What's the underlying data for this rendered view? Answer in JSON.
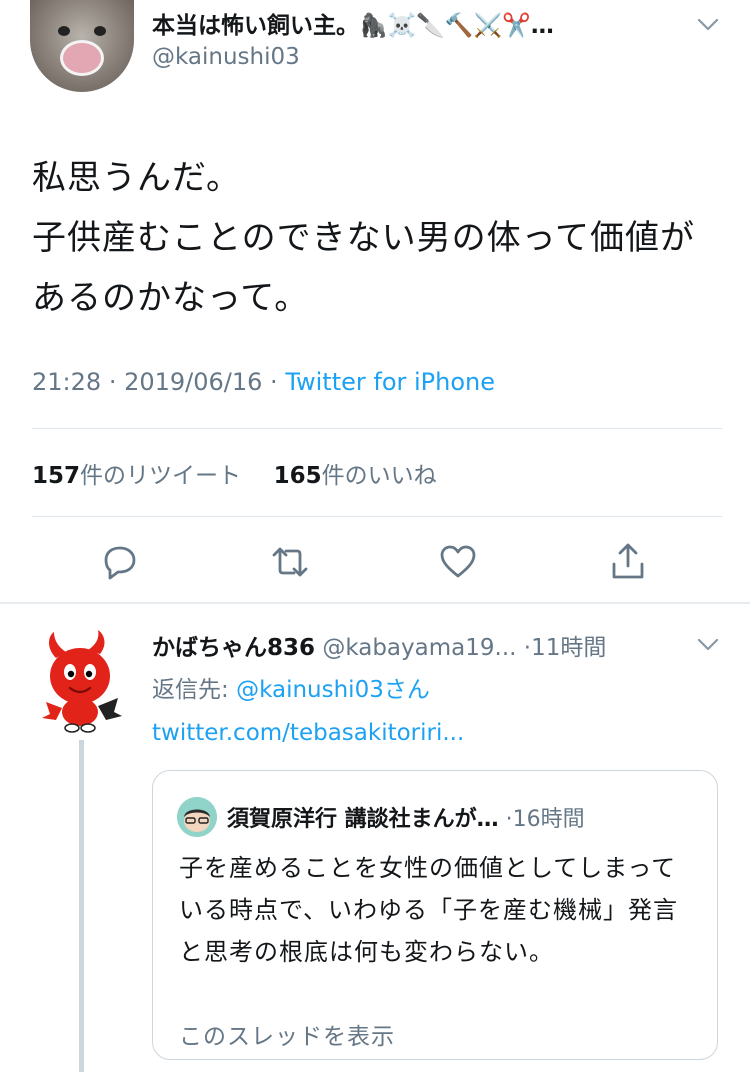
{
  "tweet": {
    "display_name": "本当は怖い飼い主。🦍☠️🔪🔨⚔️✂️…",
    "handle": "@kainushi03",
    "text": "私思うんだ。\n子供産むことのできない男の体って価値があるのかなって。",
    "time": "21:28",
    "date": "2019/06/16",
    "source": "Twitter for iPhone",
    "retweet_count": "157",
    "retweet_label": "件のリツイート",
    "like_count": "165",
    "like_label": "件のいいね"
  },
  "reply": {
    "display_name": "かばちゃん836",
    "handle": "@kabayama19...",
    "time": "11時間",
    "reply_to_label": "返信先: ",
    "reply_to_mention": "@kainushi03さん",
    "link_text": "twitter.com/tebasakitoriri..."
  },
  "quote": {
    "display_name": "須賀原洋行 講談社まんが…",
    "time": "16時間",
    "text": "子を産めることを女性の価値としてしまっている時点で、いわゆる「子を産む機械」発言と思考の根底は何も変わらない。",
    "show_thread": "このスレッドを表示"
  },
  "icons": {
    "actions": [
      "reply-icon",
      "retweet-icon",
      "like-icon",
      "share-icon"
    ],
    "caret": "chevron-down-icon"
  },
  "colors": {
    "link": "#1da1f2",
    "secondary_text": "#657786",
    "divider": "#e1e8ed"
  }
}
